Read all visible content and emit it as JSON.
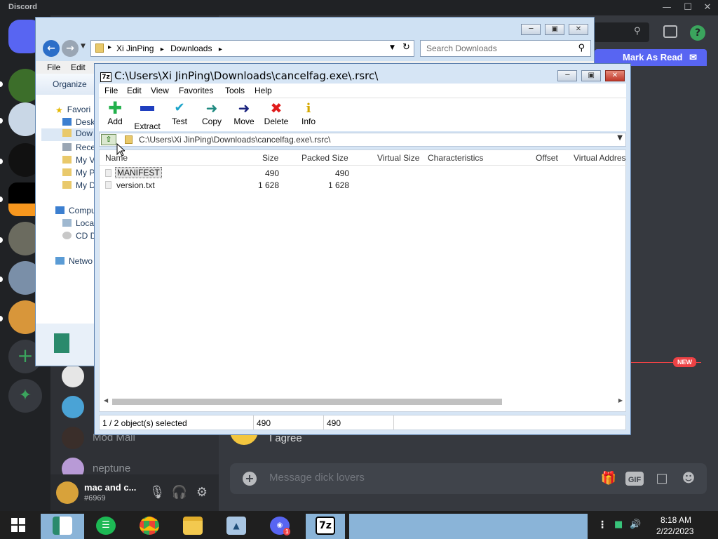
{
  "discord": {
    "app_title": "Discord",
    "mark_as_read": "Mark As Read",
    "new_badge": "NEW",
    "dm_names": [
      "Mod Mail",
      "neptune"
    ],
    "user": {
      "name": "mac and c...",
      "tag": "#6969"
    },
    "message_text": "I agree",
    "message_placeholder": "Message dick lovers",
    "gif_label": "GIF"
  },
  "explorer": {
    "breadcrumbs": [
      "Xi JinPing",
      "Downloads"
    ],
    "search_placeholder": "Search Downloads",
    "menu": [
      "File",
      "Edit"
    ],
    "organize": "Organize",
    "nav_items": [
      "Favori",
      "Desk",
      "Dow",
      "Rece",
      "My V",
      "My P",
      "My D",
      "Compu",
      "Loca",
      "CD D",
      "Netwo"
    ]
  },
  "sevenzip": {
    "title": "C:\\Users\\Xi JinPing\\Downloads\\cancelfag.exe\\.rsrc\\",
    "logo": "7z",
    "menu": [
      "File",
      "Edit",
      "View",
      "Favorites",
      "Tools",
      "Help"
    ],
    "toolbar": [
      {
        "label": "Add",
        "icon": "plus-icon",
        "color": "#22b14c"
      },
      {
        "label": "Extract",
        "icon": "minus-icon",
        "color": "#1f3fbf"
      },
      {
        "label": "Test",
        "icon": "check-icon",
        "color": "#1aa3c9"
      },
      {
        "label": "Copy",
        "icon": "copy-arrow-icon",
        "color": "#1f8a80"
      },
      {
        "label": "Move",
        "icon": "move-arrow-icon",
        "color": "#1a237e"
      },
      {
        "label": "Delete",
        "icon": "delete-x-icon",
        "color": "#e01b1b"
      },
      {
        "label": "Info",
        "icon": "info-icon",
        "color": "#e6b800"
      }
    ],
    "path": "C:\\Users\\Xi JinPing\\Downloads\\cancelfag.exe\\.rsrc\\",
    "columns": [
      "Name",
      "Size",
      "Packed Size",
      "Virtual Size",
      "Characteristics",
      "Offset",
      "Virtual Addres"
    ],
    "rows": [
      {
        "name": "MANIFEST",
        "size": "490",
        "packed": "490"
      },
      {
        "name": "version.txt",
        "size": "1 628",
        "packed": "1 628"
      }
    ],
    "status": {
      "selected": "1 / 2 object(s) selected",
      "size": "490",
      "packed": "490"
    }
  },
  "taskbar": {
    "time": "8:18 AM",
    "date": "2/22/2023",
    "zip_label": "7z",
    "discord_badge": "1"
  }
}
